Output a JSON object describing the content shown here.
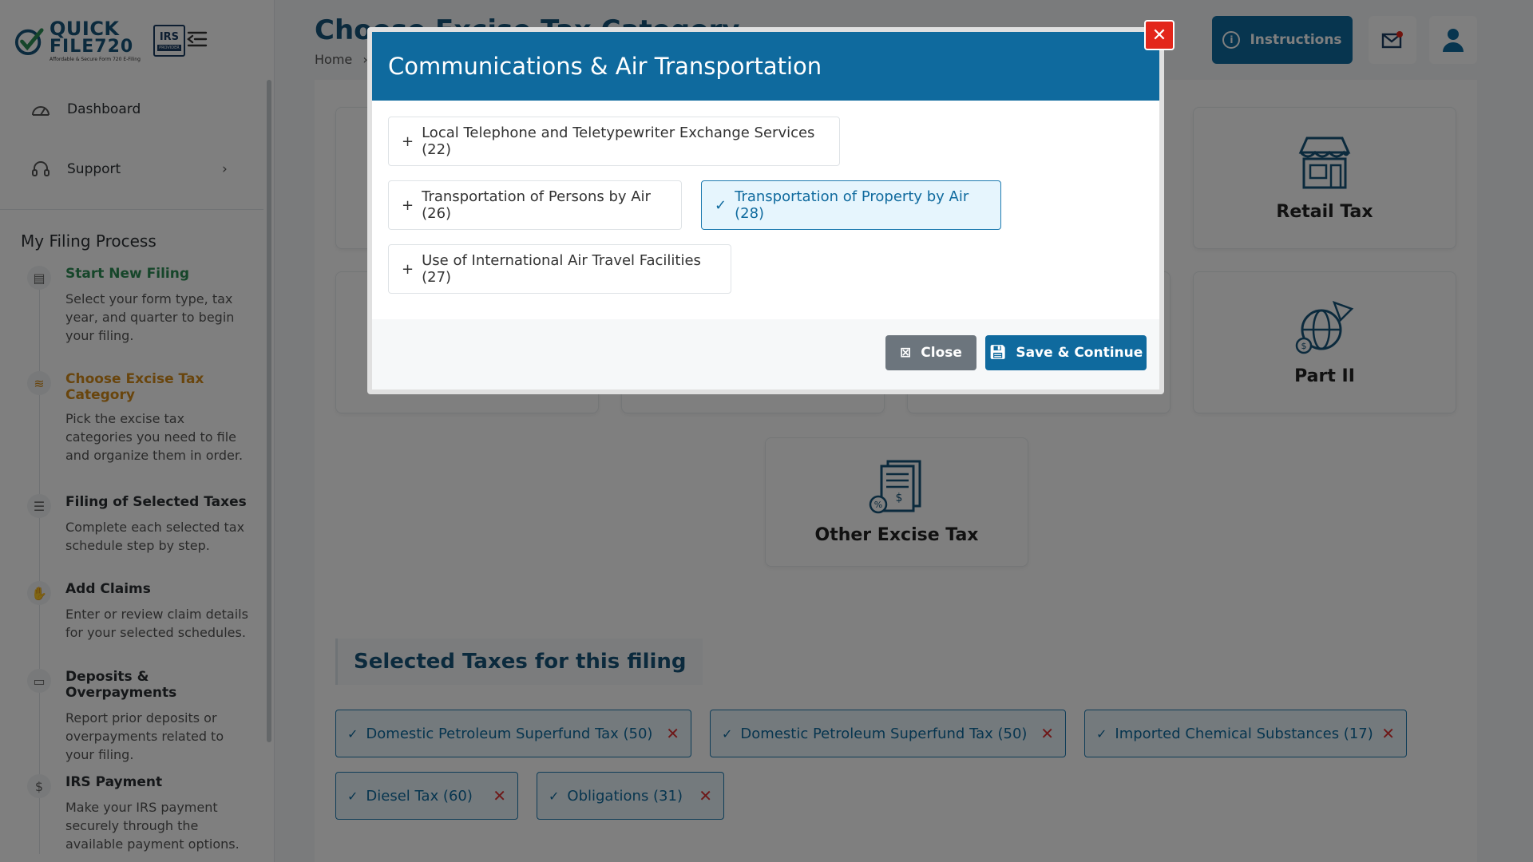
{
  "logo": {
    "line1": "QUICK",
    "line2": "FILE720",
    "tagline": "Affordable & Secure Form 720 E-Filing",
    "badge_main": "IRS",
    "badge_sub": "PROVIDER"
  },
  "sidebar": {
    "items": [
      {
        "label": "Dashboard",
        "icon": "dashboard-icon"
      },
      {
        "label": "Support",
        "icon": "headset-icon"
      }
    ],
    "process_title": "My Filing Process",
    "steps": [
      {
        "title": "Start New Filing",
        "desc": "Select your form type, tax year, and quarter to begin your filing.",
        "state": "done"
      },
      {
        "title": "Choose Excise Tax Category",
        "desc": "Pick the excise tax categories you need to file and organize them in order.",
        "state": "active"
      },
      {
        "title": "Filing of Selected Taxes",
        "desc": "Complete each selected tax schedule step by step.",
        "state": "pending"
      },
      {
        "title": "Add Claims",
        "desc": "Enter or review claim details for your selected schedules.",
        "state": "pending"
      },
      {
        "title": "Deposits & Overpayments",
        "desc": "Report prior deposits or overpayments related to your filing.",
        "state": "pending"
      },
      {
        "title": "IRS Payment",
        "desc": "Make your IRS payment securely through the available payment options.",
        "state": "pending"
      }
    ]
  },
  "header": {
    "title": "Choose Excise Tax Category",
    "breadcrumb_home": "Home",
    "breadcrumb_sep": "›",
    "instructions_label": "Instructions"
  },
  "categories": [
    {
      "label": "Retail Tax",
      "icon": "store-icon"
    },
    {
      "label": "Part II",
      "icon": "globe-money-icon"
    },
    {
      "label": "Other Excise Tax",
      "icon": "document-dollar-icon"
    }
  ],
  "selected": {
    "heading": "Selected Taxes for this filing",
    "chips": [
      "Domestic Petroleum Superfund Tax (50)",
      "Domestic Petroleum Superfund Tax (50)",
      "Imported Chemical Substances (17)",
      "Diesel Tax (60)",
      "Obligations (31)"
    ]
  },
  "modal": {
    "title": "Communications & Air Transportation",
    "options": [
      {
        "label": "Local Telephone and Teletypewriter Exchange Services (22)",
        "selected": false
      },
      {
        "label": "Transportation of Persons by Air (26)",
        "selected": false
      },
      {
        "label": "Transportation of Property by Air (28)",
        "selected": true
      },
      {
        "label": "Use of International Air Travel Facilities (27)",
        "selected": false
      }
    ],
    "close_label": "Close",
    "save_label": "Save & Continue"
  },
  "colors": {
    "primary": "#0f6a9e",
    "done": "#2d8c55",
    "active": "#d38b1a",
    "danger": "#e3261b"
  }
}
